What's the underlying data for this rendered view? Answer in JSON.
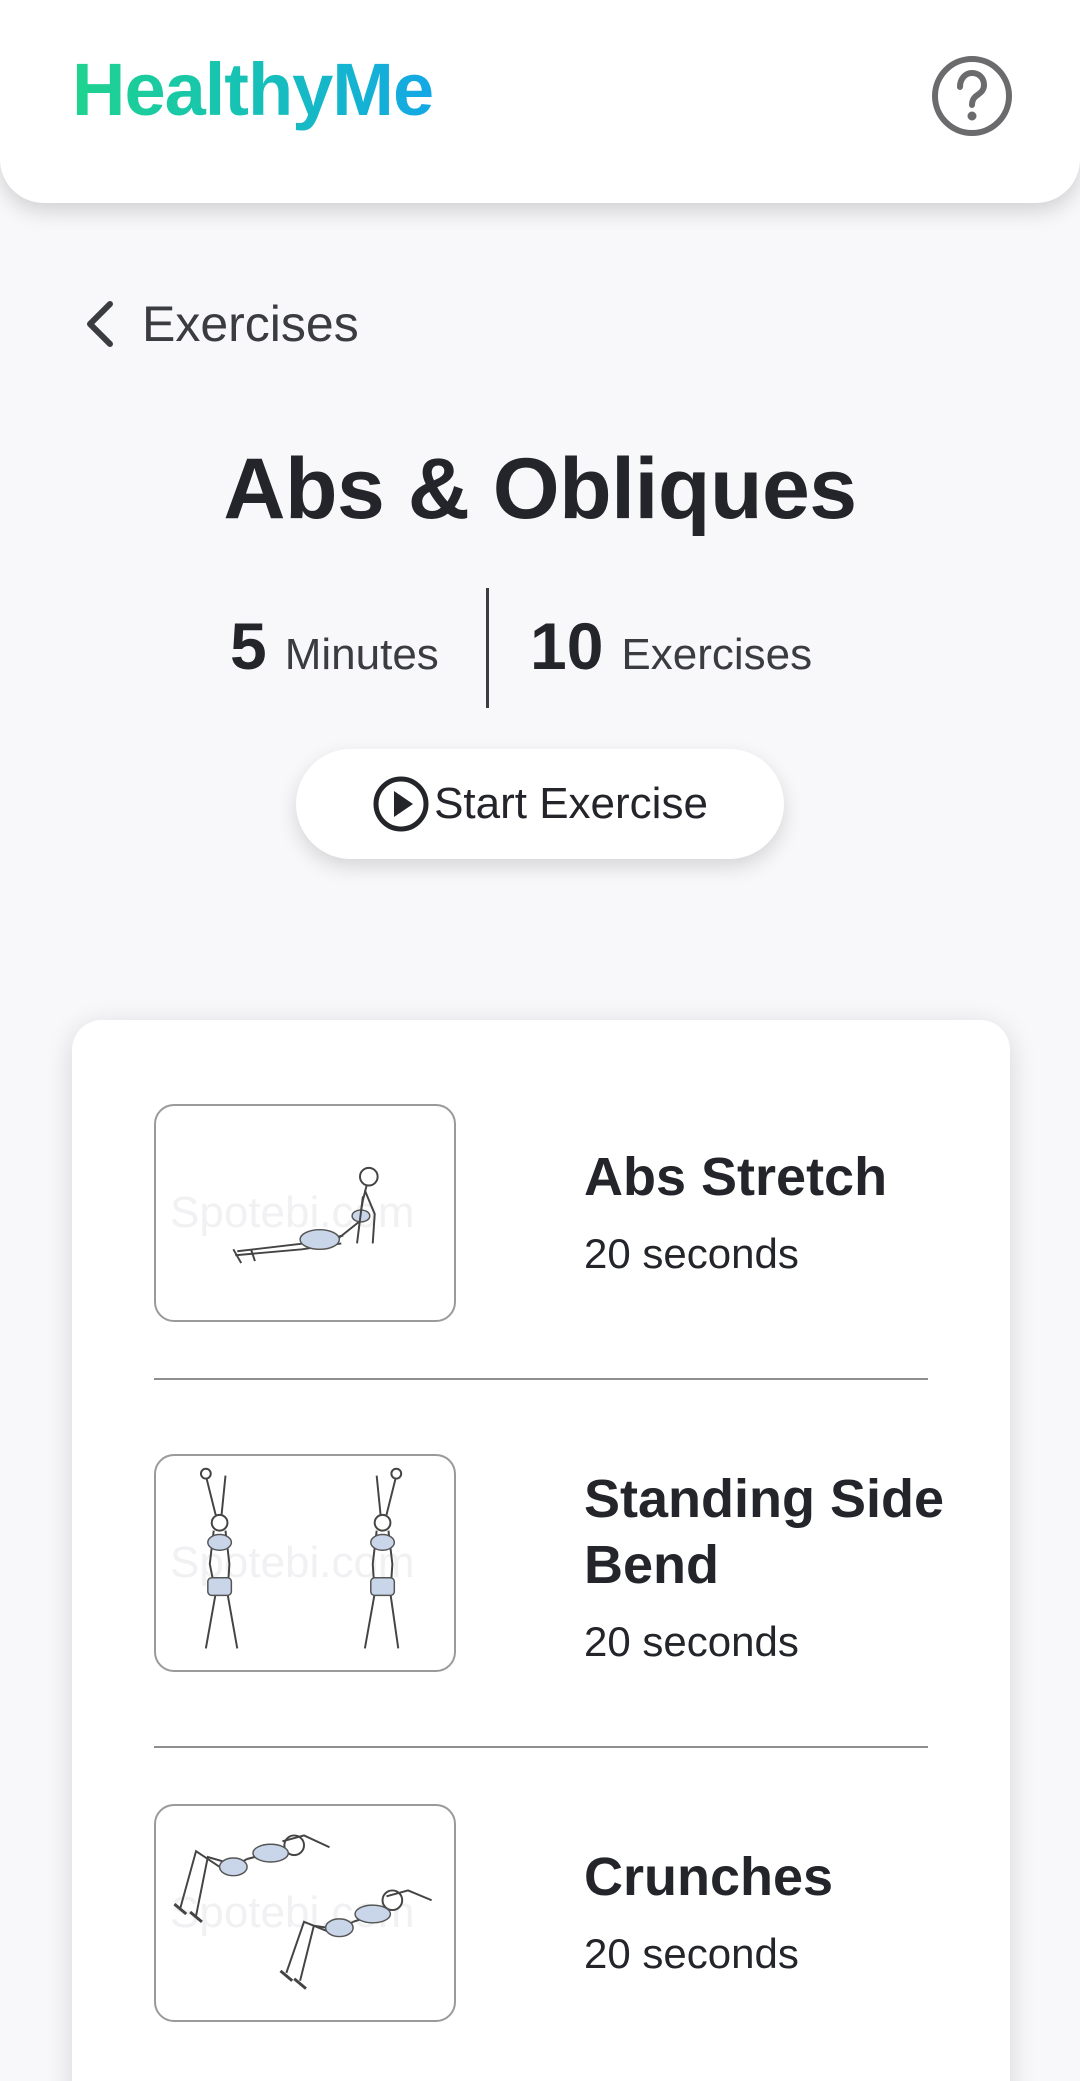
{
  "header": {
    "logo_text": "HealthyMe",
    "help_icon": "question-circle-icon"
  },
  "nav": {
    "back_label": "Exercises",
    "back_icon": "chevron-left-icon"
  },
  "workout": {
    "title": "Abs & Obliques",
    "minutes_value": "5",
    "minutes_unit": "Minutes",
    "exercises_value": "10",
    "exercises_unit": "Exercises",
    "start_label": "Start Exercise",
    "start_icon": "play-circle-icon"
  },
  "exercises": [
    {
      "name": "Abs Stretch",
      "duration": "20 seconds",
      "thumb_watermark": "Spotebi.com"
    },
    {
      "name": "Standing Side Bend",
      "duration": "20 seconds",
      "thumb_watermark": "Spotebi.com"
    },
    {
      "name": "Crunches",
      "duration": "20 seconds",
      "thumb_watermark": "Spotebi.com"
    }
  ],
  "colors": {
    "brand_gradient_start": "#1fd38e",
    "brand_gradient_end": "#13a8e6",
    "text_primary": "#23252a",
    "background": "#f8f8fa",
    "figure_fill": "#c9d6ea"
  }
}
